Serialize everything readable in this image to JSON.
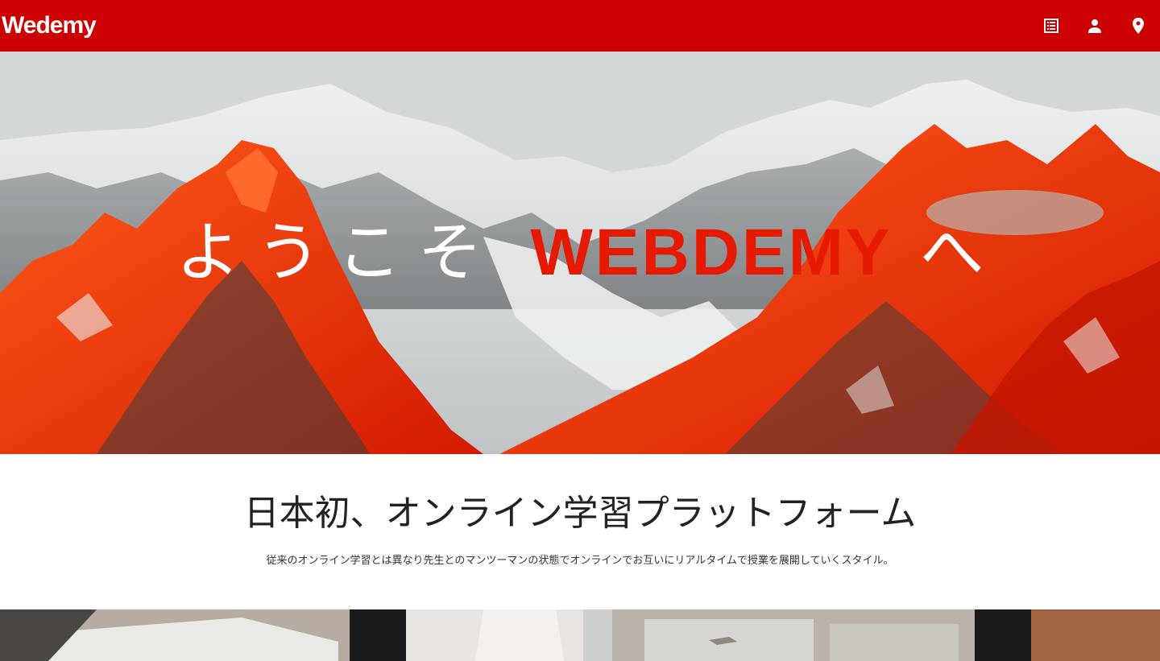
{
  "header": {
    "logo": "Wedemy",
    "background": "#cc0000",
    "icons": [
      "list-icon",
      "person-icon",
      "location-pin-icon"
    ]
  },
  "hero": {
    "prefix": "ようこそ",
    "brand": "WEBDEMY",
    "suffix": "へ",
    "brand_color": "#e51a00"
  },
  "intro": {
    "heading": "日本初、オンライン学習プラットフォーム",
    "text": "従来のオンライン学習とは異なり先生とのマンツーマンの状態でオンラインでお互いにリアルタイムで授業を展開していくスタイル。"
  }
}
